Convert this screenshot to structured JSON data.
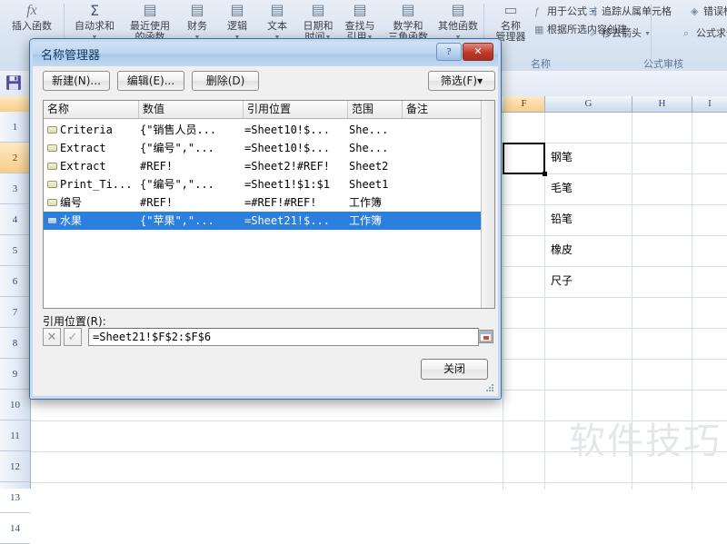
{
  "ribbon": {
    "groups": [
      {
        "caption": "",
        "buttons": [
          {
            "icon": "fx-icon",
            "label": "插入函数",
            "label2": "",
            "caret": false
          },
          {
            "icon": "sigma-icon",
            "label": "自动求和",
            "label2": "",
            "caret": true
          },
          {
            "icon": "recent-functions-icon",
            "label": "最近使用",
            "label2": "的函数",
            "caret": true
          },
          {
            "icon": "financial-icon",
            "label": "财务",
            "label2": "",
            "caret": true
          },
          {
            "icon": "logical-icon",
            "label": "逻辑",
            "label2": "",
            "caret": true
          },
          {
            "icon": "text-icon",
            "label": "文本",
            "label2": "",
            "caret": true
          },
          {
            "icon": "datetime-icon",
            "label": "日期和",
            "label2": "时间",
            "caret": true
          },
          {
            "icon": "lookup-icon",
            "label": "查找与",
            "label2": "引用",
            "caret": true
          },
          {
            "icon": "math-icon",
            "label": "数学和",
            "label2": "三角函数",
            "caret": true
          },
          {
            "icon": "more-functions-icon",
            "label": "其他函数",
            "label2": "",
            "caret": true
          }
        ]
      }
    ],
    "name_group": {
      "caption": "名称",
      "big_button": {
        "icon": "name-manager-icon",
        "label": "名称",
        "label2": "管理器"
      },
      "items": [
        {
          "icon": "use-in-formula-icon",
          "label": "用于公式",
          "caret": true
        },
        {
          "icon": "create-from-selection-icon",
          "label": "根据所选内容创建",
          "caret": false
        }
      ]
    },
    "audit_group": {
      "caption": "公式审核",
      "items": [
        {
          "icon": "trace-dependents-icon",
          "label": "追踪从属单元格",
          "caret": false
        },
        {
          "icon": "error-check-icon",
          "label": "错误检查",
          "caret": true
        },
        {
          "icon": "remove-arrows-icon",
          "label": "移去箭头",
          "caret": true
        },
        {
          "icon": "evaluate-formula-icon",
          "label": "公式求值",
          "caret": false
        }
      ]
    }
  },
  "quick_access": {
    "save_icon": "save-icon"
  },
  "sheet": {
    "columns": [
      "G",
      "H",
      "I"
    ],
    "selected_column_marker": "F",
    "rows": [
      "1",
      "2",
      "3",
      "4",
      "5",
      "6",
      "7",
      "8",
      "9",
      "10",
      "11",
      "12",
      "13",
      "14"
    ],
    "selected_row": "2",
    "cells": [
      {
        "col": "G",
        "row": "2",
        "value": "钢笔"
      },
      {
        "col": "G",
        "row": "3",
        "value": "毛笔"
      },
      {
        "col": "G",
        "row": "4",
        "value": "铅笔"
      },
      {
        "col": "G",
        "row": "5",
        "value": "橡皮"
      },
      {
        "col": "G",
        "row": "6",
        "value": "尺子"
      }
    ],
    "watermark": "软件技巧"
  },
  "dialog": {
    "title": "名称管理器",
    "window_buttons": {
      "help": "?",
      "close": "✕"
    },
    "toolbar": {
      "new": "新建(N)...",
      "edit": "编辑(E)...",
      "delete": "删除(D)",
      "filter": "筛选(F)▾"
    },
    "table": {
      "headers": [
        "名称",
        "数值",
        "引用位置",
        "范围",
        "备注"
      ],
      "rows": [
        {
          "name": "Criteria",
          "value": "{\"销售人员...",
          "refers_to": "=Sheet10!$...",
          "scope": "She...",
          "comment": "",
          "selected": false
        },
        {
          "name": "Extract",
          "value": "{\"编号\",\"...",
          "refers_to": "=Sheet10!$...",
          "scope": "She...",
          "comment": "",
          "selected": false
        },
        {
          "name": "Extract",
          "value": "#REF!",
          "refers_to": "=Sheet2!#REF!",
          "scope": "Sheet2",
          "comment": "",
          "selected": false
        },
        {
          "name": "Print_Ti...",
          "value": "{\"编号\",\"...",
          "refers_to": "=Sheet1!$1:$1",
          "scope": "Sheet1",
          "comment": "",
          "selected": false
        },
        {
          "name": "编号",
          "value": "#REF!",
          "refers_to": "=#REF!#REF!",
          "scope": "工作簿",
          "comment": "",
          "selected": false
        },
        {
          "name": "水果",
          "value": "{\"苹果\",\"...",
          "refers_to": "=Sheet21!$...",
          "scope": "工作簿",
          "comment": "",
          "selected": true
        }
      ]
    },
    "refers_to_label": "引用位置(R):",
    "refers_to_value": "=Sheet21!$F$2:$F$6",
    "cancel_edit_icon": "x-icon",
    "confirm_edit_icon": "check-icon",
    "collapse_icon": "collapse-dialog-icon",
    "close_button": "关闭"
  },
  "colors": {
    "accent": "#2a7fe0",
    "title_bar": "#bcd6f0",
    "ribbon": "#dce6f2",
    "close_red": "#c1392b",
    "selection_orange": "#f8cd8a"
  }
}
